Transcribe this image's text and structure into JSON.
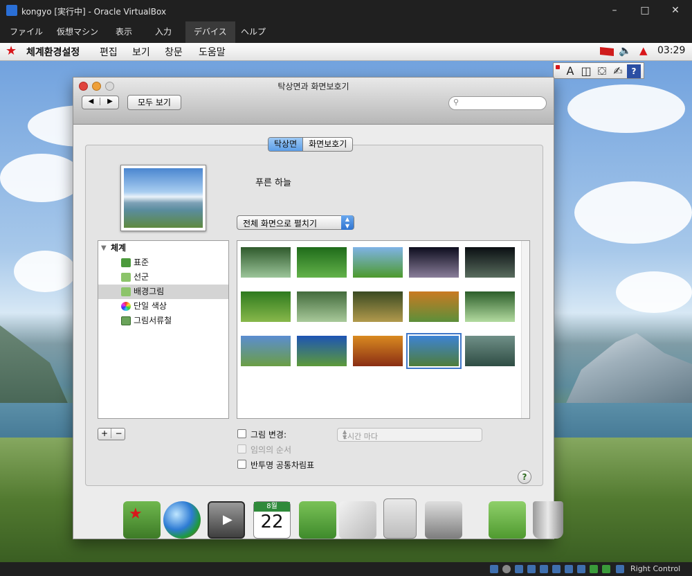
{
  "vbox": {
    "title": "kongyo [実行中] - Oracle VirtualBox",
    "menu": [
      "ファイル",
      "仮想マシン",
      "表示",
      "入力",
      "デバイス",
      "ヘルプ"
    ],
    "status_text": "Right Control",
    "min_icon": "minimize-icon",
    "max_icon": "maximize-icon",
    "close_icon": "close-icon"
  },
  "guest_menu": {
    "items": [
      "체계환경설정",
      "편집",
      "보기",
      "창문",
      "도움말"
    ],
    "clock": "03:29"
  },
  "ime": {
    "items": [
      "A",
      "◫",
      "⛋",
      "✍",
      "?"
    ]
  },
  "window": {
    "title": "탁상면과 화면보호기",
    "back": "◀",
    "forward": "▶",
    "show_all": "모두 보기",
    "search_placeholder": "",
    "tabs": [
      "탁상면",
      "화면보호기"
    ],
    "wallpaper_name": "푸른 하늘",
    "fill_mode": "전체 화면으로 펼치기",
    "sources": {
      "header": "체계",
      "items": [
        {
          "label": "표준",
          "icon": "picture-icon"
        },
        {
          "label": "선군",
          "icon": "folder-icon"
        },
        {
          "label": "배경그림",
          "icon": "folder-icon",
          "selected": true
        },
        {
          "label": "단일 색상",
          "icon": "color-wheel-icon"
        },
        {
          "label": "그림서류철",
          "icon": "photo-album-icon"
        }
      ]
    },
    "add": "+",
    "remove": "−",
    "change_picture": "그림 변경:",
    "interval": "1시간 마다",
    "random_order": "임의의 순서",
    "translucent_menu": "반투명 공통차림표",
    "help": "?",
    "thumbnails": [
      {
        "name": "bokeh-green",
        "colors": [
          "#2f5a2c",
          "#9cc59a"
        ]
      },
      {
        "name": "green-rays",
        "colors": [
          "#1f6b1a",
          "#63b24a"
        ]
      },
      {
        "name": "green-field",
        "colors": [
          "#7fb3e6",
          "#4d9a2c"
        ]
      },
      {
        "name": "galaxy-1",
        "colors": [
          "#0d0d1e",
          "#8a7e9a"
        ]
      },
      {
        "name": "galaxy-2",
        "colors": [
          "#0a0f12",
          "#596c5e"
        ]
      },
      {
        "name": "forest-path",
        "colors": [
          "#2e7a1e",
          "#88b84b"
        ]
      },
      {
        "name": "bamboo",
        "colors": [
          "#436b3c",
          "#a8c99a"
        ]
      },
      {
        "name": "forest-trunks",
        "colors": [
          "#3a4a22",
          "#b29a4c"
        ]
      },
      {
        "name": "autumn-park",
        "colors": [
          "#c97a22",
          "#5c8f3a"
        ]
      },
      {
        "name": "green-swirl",
        "colors": [
          "#2c5e2a",
          "#b3dba0"
        ]
      },
      {
        "name": "flower-meadow",
        "colors": [
          "#5b8dd1",
          "#6b9e44"
        ]
      },
      {
        "name": "blue-sky-meadow",
        "colors": [
          "#1d54b4",
          "#5d9a3a"
        ]
      },
      {
        "name": "sunset-mountains",
        "colors": [
          "#d98a20",
          "#8a2e14"
        ]
      },
      {
        "name": "blue-sky-lake",
        "colors": [
          "#3d83d4",
          "#4f7d3a"
        ],
        "selected": true
      },
      {
        "name": "misty-fjord",
        "colors": [
          "#6f8f87",
          "#2f4d44"
        ]
      }
    ]
  },
  "dock": [
    "notes-star-icon",
    "globe-icon",
    "video-player-icon",
    "calendar-icon",
    "address-book-icon",
    "preview-icon",
    "calculator-icon",
    "system-tools-icon",
    "green-folder-icon",
    "trash-icon"
  ],
  "calendar": {
    "month": "8월",
    "day": "22"
  }
}
